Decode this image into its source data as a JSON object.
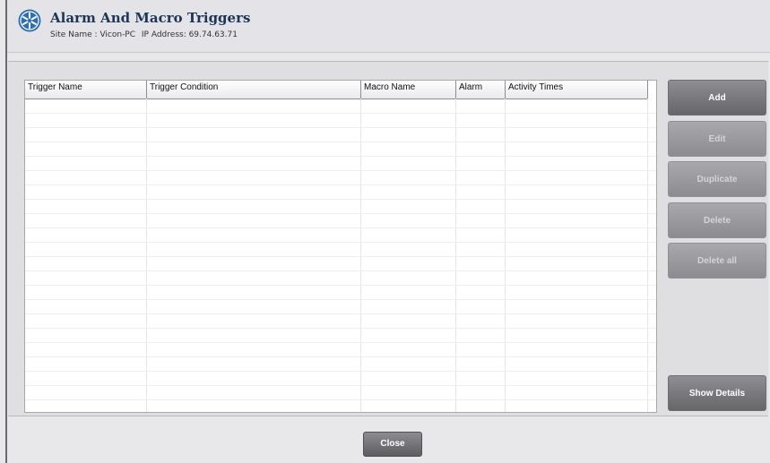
{
  "header": {
    "title": "Alarm And Macro Triggers",
    "site_name_label": "Site Name : Vicon-PC",
    "ip_address_label": "IP Address: 69.74.63.71"
  },
  "table": {
    "columns": [
      "Trigger Name",
      "Trigger Condition",
      "Macro Name",
      "Alarm",
      "Activity Times"
    ],
    "rows": []
  },
  "buttons": {
    "add": "Add",
    "edit": "Edit",
    "duplicate": "Duplicate",
    "delete": "Delete",
    "delete_all": "Delete all",
    "show_details": "Show Details",
    "close": "Close"
  },
  "colors": {
    "title": "#1d3557",
    "logo": "#2d6fb0",
    "button_enabled": "#7a7a7e",
    "button_disabled": "#9c9ca0"
  },
  "icons": {
    "logo": "vicon-logo-icon"
  }
}
